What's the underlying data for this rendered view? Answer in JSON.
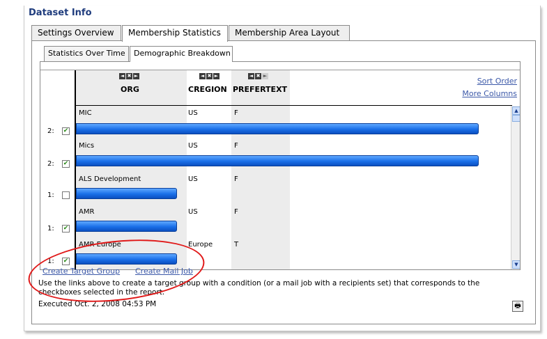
{
  "panel": {
    "title": "Dataset Info"
  },
  "tabs": [
    {
      "label": "Settings Overview"
    },
    {
      "label": "Membership Statistics"
    },
    {
      "label": "Membership Area Layout"
    }
  ],
  "subtabs": [
    {
      "label": "Statistics Over Time"
    },
    {
      "label": "Demographic Breakdown"
    }
  ],
  "table": {
    "columns": [
      "ORG",
      "CREGION",
      "PREFERTEXT"
    ],
    "col_controls": [
      "◄",
      "✖",
      "►"
    ],
    "sort_order": "Sort Order",
    "more_columns": "More Columns",
    "rows": [
      {
        "label": "2:",
        "checked": true,
        "checkmark": "✔",
        "org": "MIC",
        "cregion": "US",
        "prefertext": "F",
        "count": 2
      },
      {
        "label": "2:",
        "checked": true,
        "checkmark": "✔",
        "org": "Mics",
        "cregion": "US",
        "prefertext": "F",
        "count": 2
      },
      {
        "label": "1:",
        "checked": false,
        "checkmark": "",
        "org": "ALS Development",
        "cregion": "US",
        "prefertext": "F",
        "count": 1
      },
      {
        "label": "1:",
        "checked": true,
        "checkmark": "✔",
        "org": "AMR",
        "cregion": "US",
        "prefertext": "F",
        "count": 1
      },
      {
        "label": "1:",
        "checked": true,
        "checkmark": "✔",
        "org": "AMR Europe",
        "cregion": "Europe",
        "prefertext": "T",
        "count": 1
      }
    ],
    "scroll_up": "▲",
    "scroll_down": "▼"
  },
  "actions": {
    "create_target_group": "Create Target Group",
    "create_mail_job": "Create Mail Job"
  },
  "help_text_line1": "Use the links above to create a target group with a condition (or a mail job with a recipients set) that corresponds to the",
  "help_text_line2": "checkboxes selected in the report.",
  "executed": "Executed Oct. 2, 2008 04:53 PM",
  "print_icon": "🖶",
  "colors": {
    "accent": "#1f3c7d",
    "link": "#3b58a8",
    "bar": "#1a6fe8",
    "annotation": "#e01818"
  }
}
